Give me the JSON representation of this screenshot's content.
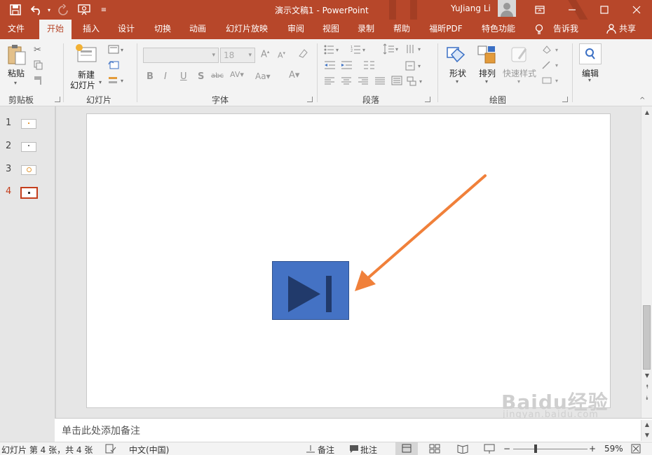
{
  "titlebar": {
    "title": "演示文稿1  -  PowerPoint",
    "user_name": "YuJiang Li"
  },
  "tabs": [
    {
      "label": "文件"
    },
    {
      "label": "开始"
    },
    {
      "label": "插入"
    },
    {
      "label": "设计"
    },
    {
      "label": "切换"
    },
    {
      "label": "动画"
    },
    {
      "label": "幻灯片放映"
    },
    {
      "label": "审阅"
    },
    {
      "label": "视图"
    },
    {
      "label": "录制"
    },
    {
      "label": "帮助"
    },
    {
      "label": "福昕PDF"
    },
    {
      "label": "特色功能"
    }
  ],
  "tell_me": "告诉我",
  "share": "共享",
  "ribbon": {
    "clipboard": {
      "paste": "粘贴",
      "group": "剪贴板"
    },
    "slides": {
      "new_slide_line1": "新建",
      "new_slide_line2": "幻灯片",
      "group": "幻灯片"
    },
    "font": {
      "font_name": "",
      "font_size": "18",
      "group": "字体"
    },
    "paragraph": {
      "group": "段落"
    },
    "drawing": {
      "shapes": "形状",
      "arrange": "排列",
      "quick_styles": "快速样式",
      "group": "绘图"
    },
    "editing": {
      "label": "编辑"
    }
  },
  "slides": [
    {
      "number": "1"
    },
    {
      "number": "2"
    },
    {
      "number": "3"
    },
    {
      "number": "4"
    }
  ],
  "notes_placeholder": "单击此处添加备注",
  "status": {
    "slide_info": "幻灯片 第 4 张，共 4 张",
    "language": "中文(中国)",
    "notes": "备注",
    "comments": "批注",
    "zoom": "59%"
  },
  "watermark": {
    "logo": "Baidu经验",
    "sub": "jingyan.baidu.com"
  },
  "colors": {
    "accent": "#b7472a",
    "media_button": "#4472c4",
    "arrow": "#f0803a",
    "active_slide": "#c43e1c"
  }
}
